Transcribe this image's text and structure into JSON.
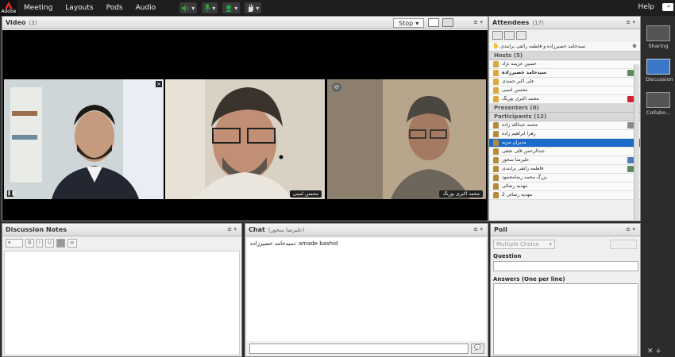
{
  "brand": {
    "logo_text": "Adobe"
  },
  "menu": {
    "items": [
      "Meeting",
      "Layouts",
      "Pods",
      "Audio"
    ],
    "help": "Help"
  },
  "colors": {
    "accent": "#1b6ac9",
    "topbar": "#1e1e1e",
    "mic_green": "#2ea043"
  },
  "video": {
    "title": "Video",
    "count": "(3)",
    "stop_label": "Stop",
    "tiles": [
      {
        "label": ""
      },
      {
        "label": "محسن امینی"
      },
      {
        "label": "محمد اکبری بورنگ"
      }
    ]
  },
  "attendees": {
    "title": "Attendees",
    "count": "(17)",
    "status_text": "سیدحامد حصیرزاده و قاطمه راتقی برابندی",
    "hosts_header": "Hosts (5)",
    "hosts": [
      "حسین عزیمه نژاد",
      "سیدحامد حصیرزاده",
      "علی اکبر حمیدی",
      "محسن امینی",
      "محمد اکبری بورنگ"
    ],
    "presenters_header": "Presenters (0)",
    "participants_header": "Participants (12)",
    "participants": [
      "محمد عبدالله زاده",
      "زهرا ابراهیم زاده",
      "مدیران مزیه",
      "عبدالرحمن قلی نجفی",
      "علیرضا سحور",
      "فاطمه راتقی برابندی",
      "بزرگ محمد رضامحمود",
      "مهدیه رضائی",
      "مهدیه رضائی 2"
    ],
    "selected_index": 2
  },
  "notes": {
    "title": "Discussion Notes"
  },
  "chat": {
    "title": "Chat",
    "subtitle": "(علیرضا سحور)",
    "message_sender": "سیدحامد حصیرزاده:",
    "message_text": "amade bashid"
  },
  "poll": {
    "title": "Poll",
    "type_value": "Multiple Choice",
    "question_label": "Question",
    "answers_label": "Answers (One per line)"
  },
  "rail": {
    "items": [
      "Sharing",
      "Discussion",
      "Collabo..."
    ],
    "active_index": 1
  }
}
